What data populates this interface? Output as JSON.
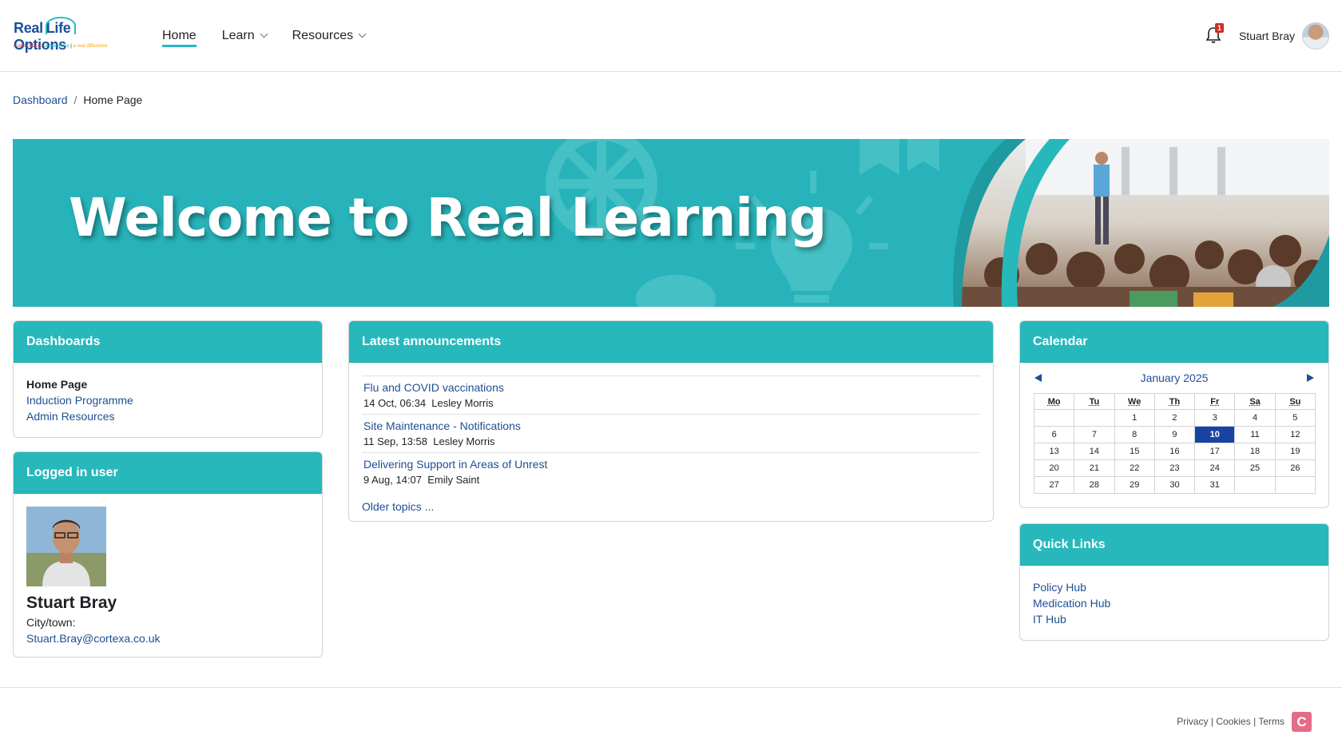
{
  "brand": {
    "logo_real": "Real",
    "logo_life": "Life",
    "logo_options": "Options",
    "tag1": "a real choice",
    "tag2": "a real voice",
    "tag3": "a real difference",
    "accent": "#26b8bb",
    "link_color": "#1f4e93"
  },
  "nav": {
    "home": "Home",
    "learn": "Learn",
    "resources": "Resources"
  },
  "header": {
    "notification_count": "1",
    "user_name": "Stuart Bray"
  },
  "breadcrumb": {
    "dashboard": "Dashboard",
    "separator": "/",
    "current": "Home Page"
  },
  "banner": {
    "title": "Welcome to Real Learning"
  },
  "dashboards": {
    "title": "Dashboards",
    "items": [
      "Home Page",
      "Induction Programme",
      "Admin Resources"
    ]
  },
  "logged_user": {
    "title": "Logged in user",
    "name": "Stuart Bray",
    "city_label": "City/town:",
    "email": "Stuart.Bray@cortexa.co.uk"
  },
  "announcements": {
    "title": "Latest announcements",
    "topics": [
      {
        "subject": "Flu and COVID vaccinations",
        "date": "14 Oct, 06:34",
        "author": "Lesley Morris"
      },
      {
        "subject": "Site Maintenance - Notifications",
        "date": "11 Sep, 13:58",
        "author": "Lesley Morris"
      },
      {
        "subject": "Delivering Support in Areas of Unrest",
        "date": "9 Aug, 14:07",
        "author": "Emily Saint"
      }
    ],
    "older": "Older topics ..."
  },
  "calendar": {
    "title": "Calendar",
    "month": "January 2025",
    "weekdays": [
      "Mo",
      "Tu",
      "We",
      "Th",
      "Fr",
      "Sa",
      "Su"
    ],
    "weeks": [
      [
        "",
        "",
        "1",
        "2",
        "3",
        "4",
        "5"
      ],
      [
        "6",
        "7",
        "8",
        "9",
        "10",
        "11",
        "12"
      ],
      [
        "13",
        "14",
        "15",
        "16",
        "17",
        "18",
        "19"
      ],
      [
        "20",
        "21",
        "22",
        "23",
        "24",
        "25",
        "26"
      ],
      [
        "27",
        "28",
        "29",
        "30",
        "31",
        "",
        ""
      ]
    ],
    "today": "10"
  },
  "quick_links": {
    "title": "Quick Links",
    "items": [
      "Policy Hub",
      "Medication Hub",
      "IT Hub"
    ]
  },
  "footer": {
    "privacy": "Privacy",
    "cookies": "Cookies",
    "terms": "Terms",
    "sep": "|",
    "logo_letter": "C"
  }
}
